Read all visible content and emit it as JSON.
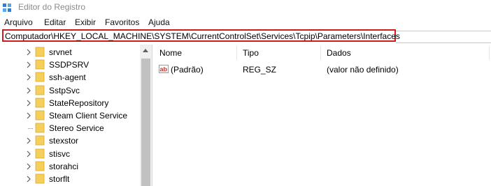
{
  "window": {
    "title": "Editor do Registro"
  },
  "menu": [
    "Arquivo",
    "Editar",
    "Exibir",
    "Favoritos",
    "Ajuda"
  ],
  "address": {
    "path": "Computador\\HKEY_LOCAL_MACHINE\\SYSTEM\\CurrentControlSet\\Services\\Tcpip\\Parameters\\Interfaces"
  },
  "tree": {
    "items": [
      {
        "label": "srvnet",
        "expandable": true
      },
      {
        "label": "SSDPSRV",
        "expandable": true
      },
      {
        "label": "ssh-agent",
        "expandable": true
      },
      {
        "label": "SstpSvc",
        "expandable": true
      },
      {
        "label": "StateRepository",
        "expandable": true
      },
      {
        "label": "Steam Client Service",
        "expandable": true
      },
      {
        "label": "Stereo Service",
        "expandable": false
      },
      {
        "label": "stexstor",
        "expandable": true
      },
      {
        "label": "stisvc",
        "expandable": true
      },
      {
        "label": "storahci",
        "expandable": true
      },
      {
        "label": "storflt",
        "expandable": true
      }
    ]
  },
  "list": {
    "columns": [
      "Nome",
      "Tipo",
      "Dados"
    ],
    "rows": [
      {
        "name": "(Padrão)",
        "type": "REG_SZ",
        "data": "(valor não definido)",
        "icon": "string-value-icon"
      }
    ]
  },
  "colors": {
    "address_highlight": "#d01b1b",
    "folder": "#f5cf5b"
  }
}
